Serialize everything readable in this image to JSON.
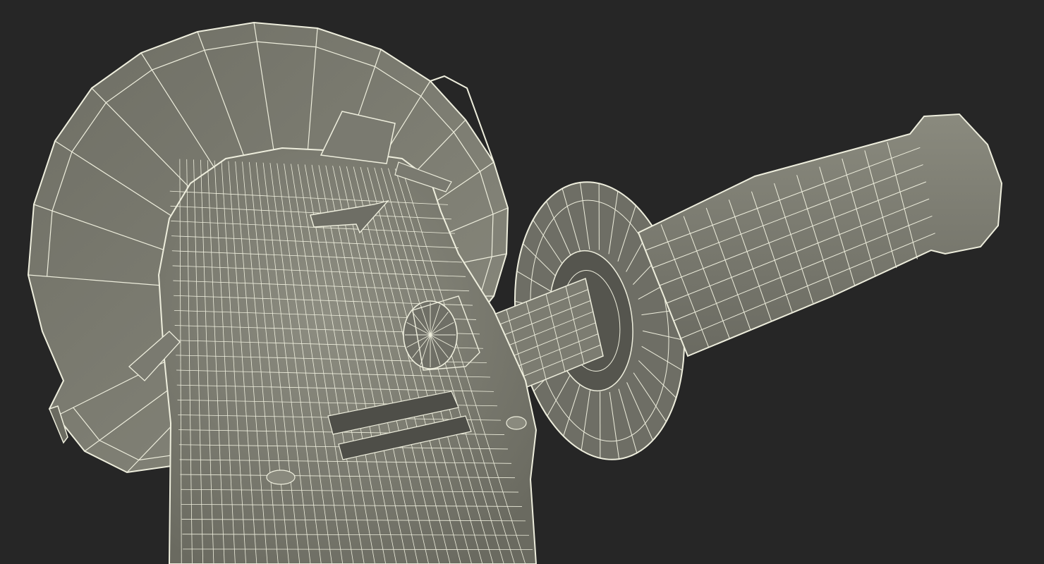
{
  "scene": {
    "subject": "angle-grinder-wireframe",
    "colors": {
      "background": "#262626",
      "surface": "#7b7b70",
      "surface_light": "#8c8c80",
      "surface_dark": "#5f5f56",
      "wire": "#eeeedd",
      "shadow": "#4d4d46"
    }
  }
}
